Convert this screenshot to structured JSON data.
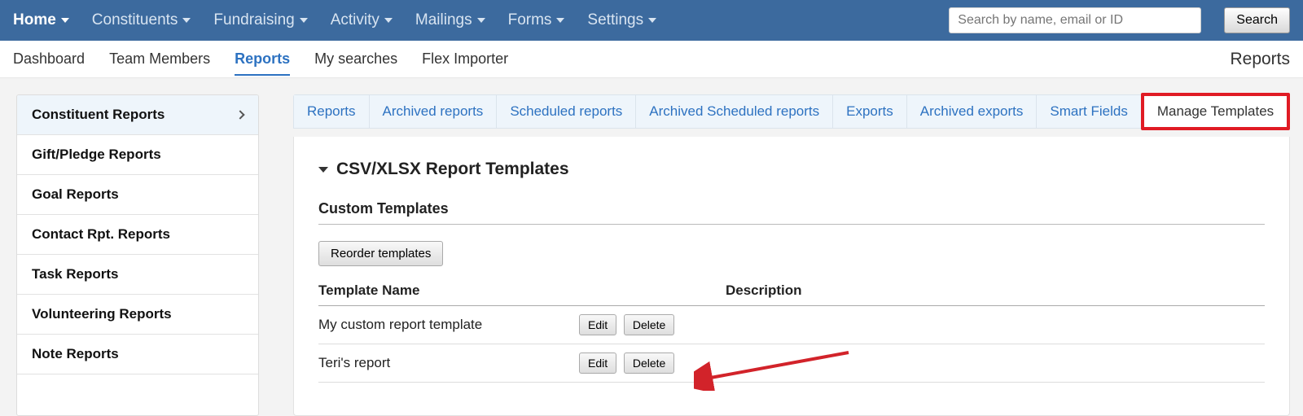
{
  "topnav": {
    "items": [
      {
        "label": "Home",
        "active": true
      },
      {
        "label": "Constituents",
        "active": false
      },
      {
        "label": "Fundraising",
        "active": false
      },
      {
        "label": "Activity",
        "active": false
      },
      {
        "label": "Mailings",
        "active": false
      },
      {
        "label": "Forms",
        "active": false
      },
      {
        "label": "Settings",
        "active": false
      }
    ],
    "search_placeholder": "Search by name, email or ID",
    "search_button": "Search"
  },
  "subnav": {
    "items": [
      {
        "label": "Dashboard",
        "active": false
      },
      {
        "label": "Team Members",
        "active": false
      },
      {
        "label": "Reports",
        "active": true
      },
      {
        "label": "My searches",
        "active": false
      },
      {
        "label": "Flex Importer",
        "active": false
      }
    ],
    "page_title": "Reports"
  },
  "sidebar": {
    "items": [
      {
        "label": "Constituent Reports",
        "active": true,
        "chevron": true
      },
      {
        "label": "Gift/Pledge Reports"
      },
      {
        "label": "Goal Reports"
      },
      {
        "label": "Contact Rpt. Reports"
      },
      {
        "label": "Task Reports"
      },
      {
        "label": "Volunteering Reports"
      },
      {
        "label": "Note Reports"
      }
    ]
  },
  "tabs": [
    {
      "label": "Reports"
    },
    {
      "label": "Archived reports"
    },
    {
      "label": "Scheduled reports"
    },
    {
      "label": "Archived Scheduled reports"
    },
    {
      "label": "Exports"
    },
    {
      "label": "Archived exports"
    },
    {
      "label": "Smart Fields"
    },
    {
      "label": "Manage Templates",
      "active": true
    }
  ],
  "panel": {
    "section_title": "CSV/XLSX Report Templates",
    "subsection_title": "Custom Templates",
    "reorder_button": "Reorder templates",
    "columns": {
      "name": "Template Name",
      "desc": "Description"
    },
    "rows": [
      {
        "name": "My custom report template",
        "desc": ""
      },
      {
        "name": "Teri's report",
        "desc": ""
      }
    ],
    "edit_label": "Edit",
    "delete_label": "Delete"
  }
}
